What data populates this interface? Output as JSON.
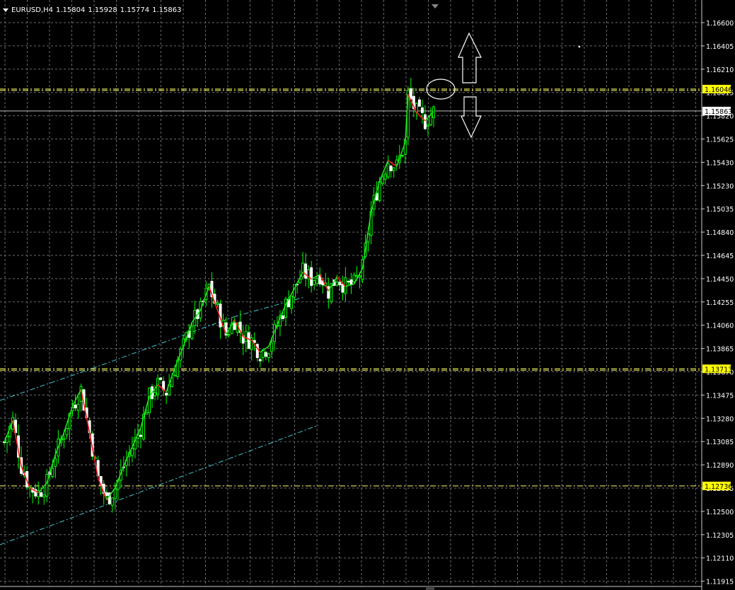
{
  "header": {
    "symbol_timeframe": "EURUSD,H4",
    "open": "1.15804",
    "high": "1.15928",
    "low": "1.15774",
    "close": "1.15863"
  },
  "colors": {
    "background": "#000000",
    "grid": "#6b6b6b",
    "candle_bull": "#00ff00",
    "candle_bear": "#ffffff",
    "ma_up": "#22e022",
    "ma_down": "#ff1a1a",
    "level_line": "#ffff66",
    "channel": "#40c8d0",
    "bid_line": "#c0c0c0"
  },
  "chart_data": {
    "type": "candlestick",
    "symbol": "EURUSD",
    "timeframe": "H4",
    "ylim": [
      1.11915,
      1.16795
    ],
    "y_ticks": [
      "1.16600",
      "1.16405",
      "1.16210",
      "1.16015",
      "1.15820",
      "1.15625",
      "1.15430",
      "1.15230",
      "1.15035",
      "1.14840",
      "1.14645",
      "1.14450",
      "1.14255",
      "1.14060",
      "1.13865",
      "1.13670",
      "1.13475",
      "1.13280",
      "1.13085",
      "1.12890",
      "1.12695",
      "1.12500",
      "1.12305",
      "1.12110",
      "1.11915"
    ],
    "price_labels": [
      {
        "value": "1.16046",
        "kind": "level"
      },
      {
        "value": "1.15863",
        "kind": "bid"
      },
      {
        "value": "1.13713",
        "kind": "level"
      },
      {
        "value": "1.12736",
        "kind": "level"
      }
    ],
    "horizontal_levels": [
      1.16046,
      1.13713,
      1.12736
    ],
    "bid": 1.15863,
    "grid": true,
    "series": [
      {
        "name": "candles",
        "keypoints": [
          [
            0,
            1.131
          ],
          [
            3,
            1.1328
          ],
          [
            6,
            1.129
          ],
          [
            9,
            1.1272
          ],
          [
            12,
            1.1268
          ],
          [
            15,
            1.1276
          ],
          [
            18,
            1.13
          ],
          [
            21,
            1.1318
          ],
          [
            24,
            1.134
          ],
          [
            27,
            1.1354
          ],
          [
            30,
            1.1318
          ],
          [
            33,
            1.128
          ],
          [
            36,
            1.1262
          ],
          [
            39,
            1.1272
          ],
          [
            42,
            1.129
          ],
          [
            45,
            1.1306
          ],
          [
            48,
            1.1322
          ],
          [
            51,
            1.1348
          ],
          [
            54,
            1.1358
          ],
          [
            57,
            1.1352
          ],
          [
            60,
            1.1372
          ],
          [
            63,
            1.139
          ],
          [
            66,
            1.141
          ],
          [
            69,
            1.142
          ],
          [
            72,
            1.144
          ],
          [
            75,
            1.142
          ],
          [
            78,
            1.14
          ],
          [
            81,
            1.1412
          ],
          [
            84,
            1.1398
          ],
          [
            87,
            1.1395
          ],
          [
            90,
            1.1385
          ],
          [
            93,
            1.139
          ],
          [
            96,
            1.1408
          ],
          [
            99,
            1.1425
          ],
          [
            102,
            1.1438
          ],
          [
            105,
            1.1452
          ],
          [
            108,
            1.1446
          ],
          [
            111,
            1.145
          ],
          [
            114,
            1.1436
          ],
          [
            117,
            1.1448
          ],
          [
            120,
            1.144
          ],
          [
            123,
            1.1442
          ],
          [
            126,
            1.1455
          ],
          [
            129,
            1.1502
          ],
          [
            132,
            1.1528
          ],
          [
            135,
            1.1545
          ],
          [
            138,
            1.154
          ],
          [
            141,
            1.156
          ],
          [
            142,
            1.16
          ],
          [
            145,
            1.1585
          ],
          [
            148,
            1.1578
          ],
          [
            151,
            1.1586
          ]
        ]
      }
    ]
  }
}
